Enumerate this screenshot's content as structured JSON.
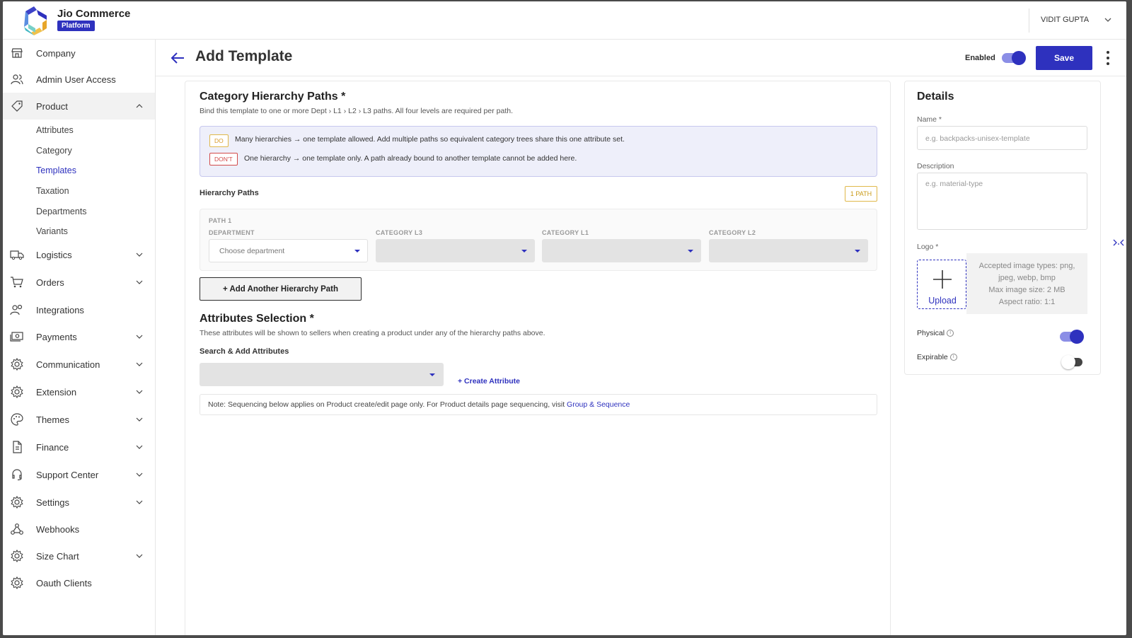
{
  "app": {
    "brand": "Jio Commerce",
    "badge": "Platform"
  },
  "user": {
    "name": "VIDIT GUPTA"
  },
  "colors": {
    "primary": "#2e31be",
    "toggle_on_track": "#8b8ee6",
    "toggle_off_knob": "#444444"
  },
  "sidebar": {
    "items": [
      {
        "label": "Company",
        "icon": "store-icon"
      },
      {
        "label": "Admin User Access",
        "icon": "users-icon"
      },
      {
        "label": "Product",
        "icon": "tag-icon",
        "expanded": true
      },
      {
        "label": "Logistics",
        "icon": "truck-icon"
      },
      {
        "label": "Orders",
        "icon": "cart-icon"
      },
      {
        "label": "Integrations",
        "icon": "people-icon"
      },
      {
        "label": "Payments",
        "icon": "cash-icon"
      },
      {
        "label": "Communication",
        "icon": "gear-icon"
      },
      {
        "label": "Extension",
        "icon": "gear-icon"
      },
      {
        "label": "Themes",
        "icon": "palette-icon"
      },
      {
        "label": "Finance",
        "icon": "document-icon"
      },
      {
        "label": "Support Center",
        "icon": "headset-icon"
      },
      {
        "label": "Settings",
        "icon": "gear-icon"
      },
      {
        "label": "Webhooks",
        "icon": "webhook-icon"
      },
      {
        "label": "Size Chart",
        "icon": "gear-icon"
      },
      {
        "label": "Oauth Clients",
        "icon": "gear-icon"
      }
    ],
    "product_sub": [
      "Attributes",
      "Category",
      "Templates",
      "Taxation",
      "Departments",
      "Variants"
    ]
  },
  "header": {
    "title": "Add Template",
    "enabled_label": "Enabled",
    "enabled": true,
    "save_label": "Save"
  },
  "hierarchy": {
    "title": "Category Hierarchy Paths *",
    "subtitle": "Bind this template to one or more Dept › L1 › L2 › L3 paths. All four levels are required per path.",
    "do_tag": "DO",
    "do_text": "Many hierarchies → one template allowed. Add multiple paths so equivalent category trees share this one attribute set.",
    "dont_tag": "DON'T",
    "dont_text": "One hierarchy → one template only. A path already bound to another template cannot be added here.",
    "paths_label": "Hierarchy Paths",
    "path_count": "1 PATH",
    "path_name": "PATH 1",
    "columns": [
      "DEPARTMENT",
      "CATEGORY L3",
      "CATEGORY L1",
      "CATEGORY L2"
    ],
    "department_placeholder": "Choose department",
    "add_path_label": "+ Add Another Hierarchy Path"
  },
  "attributes": {
    "title": "Attributes Selection *",
    "subtitle": "These attributes will be shown to sellers when creating a product under any of the hierarchy paths above.",
    "search_label": "Search & Add Attributes",
    "create_label": "+ Create Attribute",
    "note_text": "Note: Sequencing below applies on Product create/edit page only. For Product details page sequencing, visit ",
    "note_link": "Group & Sequence"
  },
  "details": {
    "title": "Details",
    "name_label": "Name *",
    "name_placeholder": "e.g. backpacks-unisex-template",
    "description_label": "Description",
    "description_placeholder": "e.g. material-type",
    "logo_label": "Logo *",
    "upload_label": "Upload",
    "upload_info": [
      "Accepted image types: png,",
      "jpeg, webp, bmp",
      "Max image size: 2 MB",
      "Aspect ratio: 1:1"
    ],
    "physical_label": "Physical",
    "physical": true,
    "expirable_label": "Expirable",
    "expirable": false
  }
}
